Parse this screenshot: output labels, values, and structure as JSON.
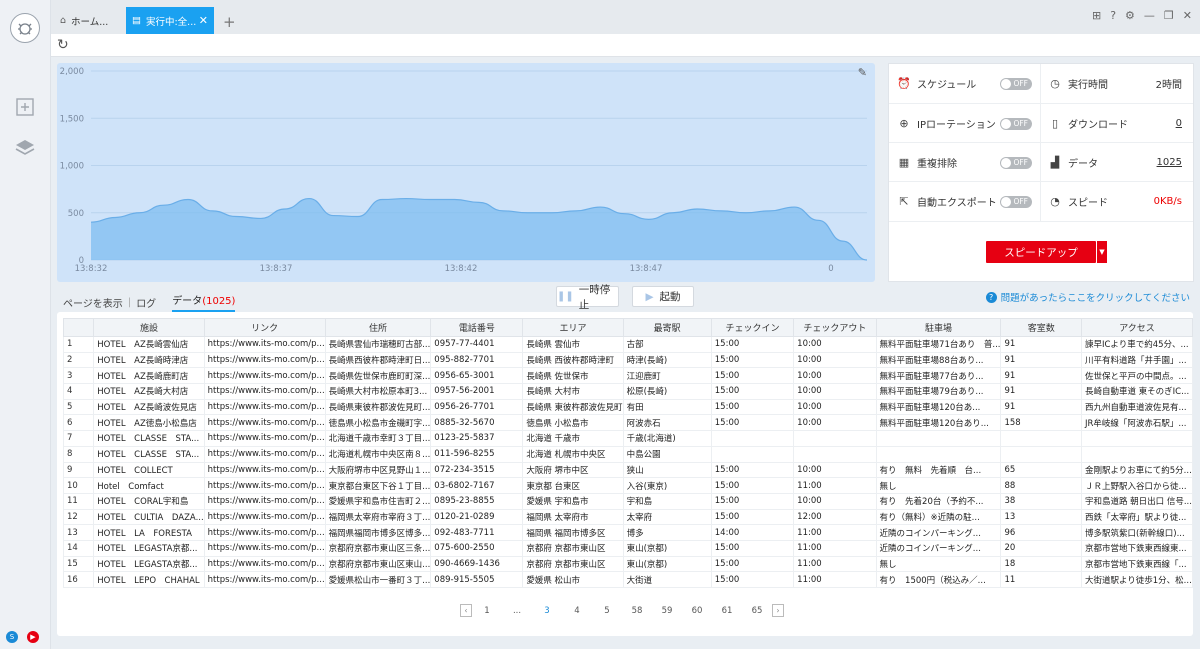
{
  "tabs": [
    {
      "label": "ホーム..."
    },
    {
      "label": "実行中:全..."
    }
  ],
  "stats": {
    "schedule": {
      "label": "スケジュール",
      "toggle": "OFF"
    },
    "runtime": {
      "label": "実行時間",
      "value": "2時間"
    },
    "ip_rotation": {
      "label": "IPローテーション",
      "toggle": "OFF"
    },
    "download": {
      "label": "ダウンロード",
      "value": "0"
    },
    "dedup": {
      "label": "重複排除",
      "toggle": "OFF"
    },
    "data": {
      "label": "データ",
      "value": "1025"
    },
    "auto_export": {
      "label": "自動エクスポート",
      "toggle": "OFF"
    },
    "speed": {
      "label": "スピード",
      "value": "0KB/s"
    },
    "speedup_label": "スピードアップ"
  },
  "view_tabs": {
    "page": "ページを表示",
    "log": "ログ",
    "data": "データ",
    "data_count": "(1025)"
  },
  "controls": {
    "pause": "一時停止",
    "start": "起動"
  },
  "help_text": "問題があったらここをクリックしてください",
  "table": {
    "columns": [
      "",
      "施設",
      "リンク",
      "住所",
      "電話番号",
      "エリア",
      "最寄駅",
      "チェックイン",
      "チェックアウト",
      "駐車場",
      "客室数",
      "アクセス"
    ],
    "rows": [
      [
        "1",
        "HOTEL　AZ長崎雲仙店",
        "https://www.its-mo.com/p...",
        "長崎県雲仙市瑞穂町古部...",
        "0957-77-4401",
        "長崎県 雲仙市",
        "古部",
        "15:00",
        "10:00",
        "無料平面駐車場71台あり　普...",
        "91",
        "諫早ICより車で約45分、..."
      ],
      [
        "2",
        "HOTEL　AZ長崎時津店",
        "https://www.its-mo.com/p...",
        "長崎県西彼杵郡時津町日...",
        "095-882-7701",
        "長崎県 西彼杵郡時津町",
        "時津(長崎)",
        "15:00",
        "10:00",
        "無料平面駐車場88台あり...",
        "91",
        "川平有料道路「井手園」..."
      ],
      [
        "3",
        "HOTEL　AZ長崎鹿町店",
        "https://www.its-mo.com/p...",
        "長崎県佐世保市鹿町町深...",
        "0956-65-3001",
        "長崎県 佐世保市",
        "江迎鹿町",
        "15:00",
        "10:00",
        "無料平面駐車場77台あり...",
        "91",
        "佐世保と平戸の中間点。..."
      ],
      [
        "4",
        "HOTEL　AZ長崎大村店",
        "https://www.its-mo.com/p...",
        "長崎県大村市松原本町3...",
        "0957-56-2001",
        "長崎県 大村市",
        "松原(長崎)",
        "15:00",
        "10:00",
        "無料平面駐車場79台あり...",
        "91",
        "長崎自動車道 東そのぎIC..."
      ],
      [
        "5",
        "HOTEL　AZ長崎波佐見店",
        "https://www.its-mo.com/p...",
        "長崎県東彼杵郡波佐見町...",
        "0956-26-7701",
        "長崎県 東彼杵郡波佐見町",
        "有田",
        "15:00",
        "10:00",
        "無料平面駐車場120台あ...",
        "91",
        "西九州自動車道波佐見有..."
      ],
      [
        "6",
        "HOTEL　AZ徳島小松島店",
        "https://www.its-mo.com/p...",
        "徳島県小松島市金磯町字...",
        "0885-32-5670",
        "徳島県 小松島市",
        "阿波赤石",
        "15:00",
        "10:00",
        "無料平面駐車場120台あり...",
        "158",
        "JR牟岐線「阿波赤石駅」..."
      ],
      [
        "7",
        "HOTEL　CLASSE　STA...",
        "https://www.its-mo.com/p...",
        "北海道千歳市幸町３丁目...",
        "0123-25-5837",
        "北海道 千歳市",
        "千歳(北海道)",
        "",
        "",
        "",
        "",
        ""
      ],
      [
        "8",
        "HOTEL　CLASSE　STA...",
        "https://www.its-mo.com/p...",
        "北海道札幌市中央区南８...",
        "011-596-8255",
        "北海道 札幌市中央区",
        "中島公園",
        "",
        "",
        "",
        "",
        ""
      ],
      [
        "9",
        "HOTEL　COLLECT",
        "https://www.its-mo.com/p...",
        "大阪府堺市中区見野山１...",
        "072-234-3515",
        "大阪府 堺市中区",
        "狭山",
        "15:00",
        "10:00",
        "有り　無料　先着順　台...",
        "65",
        "金剛駅よりお車にて約5分..."
      ],
      [
        "10",
        "Hotel　Comfact",
        "https://www.its-mo.com/p...",
        "東京都台東区下谷１丁目...",
        "03-6802-7167",
        "東京都 台東区",
        "入谷(東京)",
        "15:00",
        "11:00",
        "無し",
        "88",
        "ＪＲ上野駅入谷口から徒..."
      ],
      [
        "11",
        "HOTEL　CORAL宇和島",
        "https://www.its-mo.com/p...",
        "愛媛県宇和島市住吉町２...",
        "0895-23-8855",
        "愛媛県 宇和島市",
        "宇和島",
        "15:00",
        "10:00",
        "有り　先着20台（予約不...",
        "38",
        "宇和島道路 朝日出口 信号..."
      ],
      [
        "12",
        "HOTEL　CULTIA　DAZA...",
        "https://www.its-mo.com/p...",
        "福岡県太宰府市宰府３丁...",
        "0120-21-0289",
        "福岡県 太宰府市",
        "太宰府",
        "15:00",
        "12:00",
        "有り（無料）※近隣の駐...",
        "13",
        "西鉄「太宰府」駅より徒..."
      ],
      [
        "13",
        "HOTEL　LA　FORESTA",
        "https://www.its-mo.com/p...",
        "福岡県福岡市博多区博多...",
        "092-483-7711",
        "福岡県 福岡市博多区",
        "博多",
        "14:00",
        "11:00",
        "近隣のコインパーキング...",
        "96",
        "博多駅筑紫口(新幹線口)..."
      ],
      [
        "14",
        "HOTEL　LEGASTA京都...",
        "https://www.its-mo.com/p...",
        "京都府京都市東山区三条...",
        "075-600-2550",
        "京都府 京都市東山区",
        "東山(京都)",
        "15:00",
        "11:00",
        "近隣のコインパーキング...",
        "20",
        "京都市営地下鉄東西線東..."
      ],
      [
        "15",
        "HOTEL　LEGASTA京都...",
        "https://www.its-mo.com/p...",
        "京都府京都市東山区東山...",
        "090-4669-1436",
        "京都府 京都市東山区",
        "東山(京都)",
        "15:00",
        "11:00",
        "無し",
        "18",
        "京都市営地下鉄東西線「..."
      ],
      [
        "16",
        "HOTEL　LEPO　CHAHAL",
        "https://www.its-mo.com/p...",
        "愛媛県松山市一番町３丁...",
        "089-915-5505",
        "愛媛県 松山市",
        "大街道",
        "15:00",
        "11:00",
        "有り　1500円（税込み／...",
        "11",
        "大街道駅より徒歩1分、松..."
      ]
    ]
  },
  "pager": [
    "1",
    "...",
    "3",
    "4",
    "5",
    "58",
    "59",
    "60",
    "61",
    "65"
  ],
  "pager_current": "3",
  "chart_data": {
    "type": "area",
    "x_ticks": [
      "13:8:32",
      "13:8:37",
      "13:8:42",
      "13:8:47",
      "0"
    ],
    "y_ticks": [
      "0",
      "500",
      "1,000",
      "1,500",
      "2,000"
    ],
    "ylim": [
      0,
      2000
    ],
    "series": [
      {
        "values": [
          400,
          450,
          500,
          580,
          640,
          520,
          460,
          440,
          540,
          650,
          470,
          460,
          640,
          650,
          640,
          640,
          610,
          520,
          500,
          500,
          520,
          560,
          490,
          430,
          500,
          540,
          520,
          500,
          520,
          560,
          420,
          200,
          0
        ]
      }
    ],
    "colors": {
      "fill": "#7fbdf0",
      "line": "#6aaee8",
      "background": "#cfe3f9"
    }
  }
}
